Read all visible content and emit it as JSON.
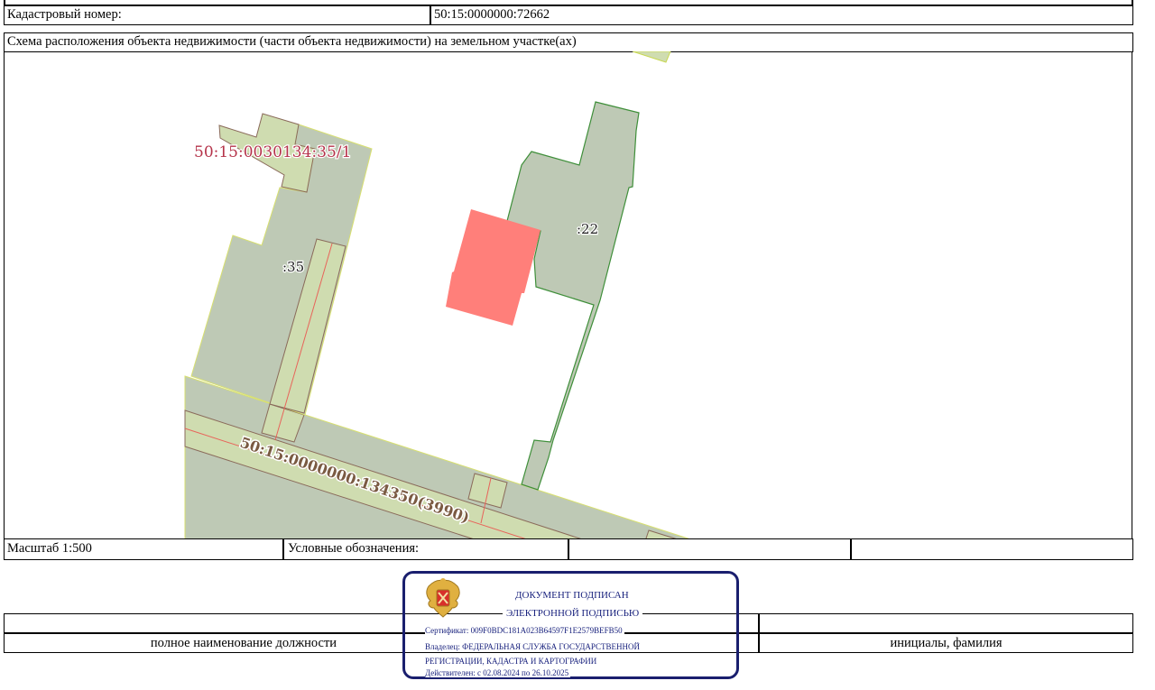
{
  "header": {
    "cadastral_label": "Кадастровый номер:",
    "cadastral_value": "50:15:0000000:72662",
    "scheme_title": "Схема расположения объекта недвижимости (части объекта недвижимости) на земельном участке(ах)"
  },
  "map": {
    "labels": {
      "parcel_35_1": "50:15:0030134:35/1",
      "parcel_35": ":35",
      "parcel_22": ":22",
      "road": "50:15:0000000:134350(3990)"
    },
    "colors": {
      "parcel_fill": "#bec9b5",
      "zone_fill": "#cfdcb0",
      "object_fill": "#ff7f7a",
      "parcel_22_border": "#3f8f3a",
      "zone_border": "#8a6a5a",
      "red_line": "#e8645a",
      "label_35_1": "#b5334a",
      "road_label": "#7a5a42"
    }
  },
  "footer": {
    "scale": "Масштаб 1:500",
    "legend_label": "Условные обозначения:"
  },
  "signature": {
    "position_caption": "полное наименование должности",
    "name_caption": "инициалы, фамилия"
  },
  "stamp": {
    "line1": "ДОКУМЕНТ ПОДПИСАН",
    "line2": "ЭЛЕКТРОННОЙ ПОДПИСЬЮ",
    "certificate": "Сертификат: 009F0BDC181A023B64597F1E2579BEFB50",
    "owner_1": "Владелец: ФЕДЕРАЛЬНАЯ СЛУЖБА ГОСУДАРСТВЕННОЙ",
    "owner_2": "РЕГИСТРАЦИИ, КАДАСТРА И КАРТОГРАФИИ",
    "validity": "Действителен: с 02.08.2024 по 26.10.2025",
    "emblem_icon": "coat-of-arms-icon"
  }
}
